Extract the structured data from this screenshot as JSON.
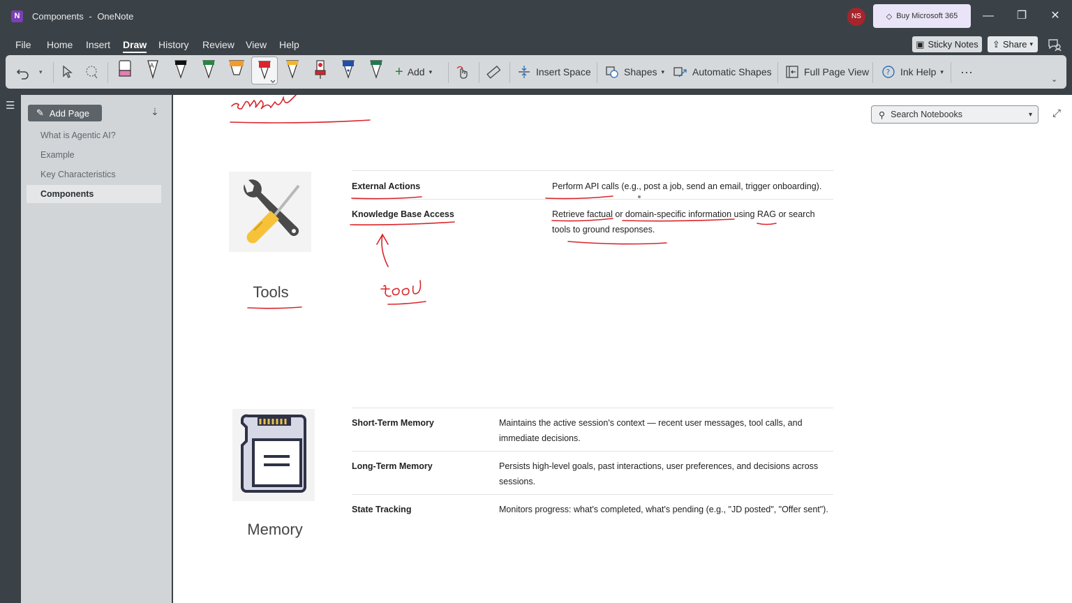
{
  "window": {
    "app_icon_letter": "N",
    "title": "Components",
    "app_name": "OneNote",
    "title_separator": "-",
    "avatar_initials": "NS",
    "buy_label": "Buy Microsoft 365",
    "buy_icon": "diamond-icon"
  },
  "menu": {
    "items": [
      "File",
      "Home",
      "Insert",
      "Draw",
      "History",
      "Review",
      "View",
      "Help"
    ],
    "active": "Draw",
    "sticky_notes": "Sticky Notes",
    "share": "Share"
  },
  "ribbon": {
    "add_label": "Add",
    "insert_space": "Insert Space",
    "shapes": "Shapes",
    "automatic_shapes": "Automatic Shapes",
    "full_page_view": "Full Page View",
    "ink_help": "Ink Help",
    "more": "···",
    "pens": [
      {
        "type": "highlighter",
        "color": "#e37fb3"
      },
      {
        "type": "pen",
        "color": "#ffffff"
      },
      {
        "type": "pen",
        "color": "#111111"
      },
      {
        "type": "pen",
        "color": "#1f8a3c"
      },
      {
        "type": "highlighter",
        "color": "#f29b2c"
      },
      {
        "type": "pen",
        "color": "#d9252b",
        "selected": true
      },
      {
        "type": "pencil",
        "color": "#f3b528"
      },
      {
        "type": "marker",
        "color": "#d9252b"
      },
      {
        "type": "fountain-pen",
        "color": "#1f4fa8"
      },
      {
        "type": "pen",
        "color": "#1f7a4a"
      }
    ]
  },
  "pages_pane": {
    "add_page": "Add Page",
    "pages": [
      "What is Agentic AI?",
      "Example",
      "Key Characteristics",
      "Components"
    ],
    "active_page": "Components"
  },
  "canvas": {
    "search_placeholder": "Search Notebooks",
    "tools_section": {
      "caption": "Tools",
      "rows": [
        {
          "key": "External Actions",
          "value": "Perform API calls (e.g., post a job, send an email, trigger onboarding)."
        },
        {
          "key": "Knowledge Base Access",
          "value": "Retrieve factual or domain-specific information using RAG or search tools to ground responses."
        }
      ],
      "handwriting": "tool"
    },
    "memory_section": {
      "caption": "Memory",
      "rows": [
        {
          "key": "Short-Term Memory",
          "value": "Maintains the active session's context — recent user messages, tool calls, and immediate decisions."
        },
        {
          "key": "Long-Term Memory",
          "value": "Persists high-level goals, past interactions, user preferences, and decisions across sessions."
        },
        {
          "key": "State Tracking",
          "value": "Monitors progress: what's completed, what's pending (e.g., \"JD posted\", \"Offer sent\")."
        }
      ]
    },
    "ink_color": "#d9252b"
  }
}
